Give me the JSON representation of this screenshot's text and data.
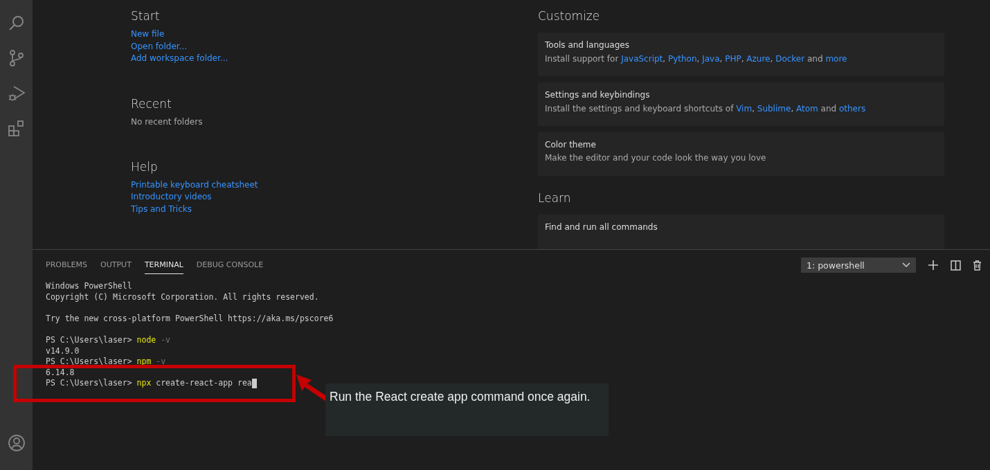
{
  "activity_bar": {
    "items": [
      {
        "kind": "search",
        "selected": false
      },
      {
        "kind": "source-control",
        "selected": false
      },
      {
        "kind": "run",
        "selected": false
      },
      {
        "kind": "extensions",
        "selected": false
      }
    ]
  },
  "welcome": {
    "left": [
      {
        "heading": "Start",
        "items": [
          {
            "text": "New file",
            "kind": "link"
          },
          {
            "text": "Open folder...",
            "kind": "link"
          },
          {
            "text": "Add workspace folder...",
            "kind": "link"
          }
        ]
      },
      {
        "heading": "Recent",
        "items": [
          {
            "text": "No recent folders",
            "kind": "plain"
          }
        ]
      },
      {
        "heading": "Help",
        "items": [
          {
            "text": "Printable keyboard cheatsheet",
            "kind": "link"
          },
          {
            "text": "Introductory videos",
            "kind": "link"
          },
          {
            "text": "Tips and Tricks",
            "kind": "link"
          }
        ]
      }
    ],
    "right": [
      {
        "heading": "Customize",
        "cards": [
          {
            "title": "Tools and languages",
            "description": [
              {
                "text": "Install support for ",
                "link": false
              },
              {
                "text": "JavaScript",
                "link": true
              },
              {
                "text": ", ",
                "link": false
              },
              {
                "text": "Python",
                "link": true
              },
              {
                "text": ", ",
                "link": false
              },
              {
                "text": "Java",
                "link": true
              },
              {
                "text": ", ",
                "link": false
              },
              {
                "text": "PHP",
                "link": true
              },
              {
                "text": ", ",
                "link": false
              },
              {
                "text": "Azure",
                "link": true
              },
              {
                "text": ", ",
                "link": false
              },
              {
                "text": "Docker",
                "link": true
              },
              {
                "text": " and ",
                "link": false
              },
              {
                "text": "more",
                "link": true
              }
            ]
          },
          {
            "title": "Settings and keybindings",
            "description": [
              {
                "text": "Install the settings and keyboard shortcuts of ",
                "link": false
              },
              {
                "text": "Vim",
                "link": true
              },
              {
                "text": ", ",
                "link": false
              },
              {
                "text": "Sublime",
                "link": true
              },
              {
                "text": ", ",
                "link": false
              },
              {
                "text": "Atom",
                "link": true
              },
              {
                "text": " and ",
                "link": false
              },
              {
                "text": "others",
                "link": true
              }
            ]
          },
          {
            "title": "Color theme",
            "description": [
              {
                "text": "Make the editor and your code look the way you love",
                "link": false
              }
            ]
          }
        ]
      },
      {
        "heading": "Learn",
        "cards": [
          {
            "title": "Find and run all commands"
          }
        ]
      }
    ]
  },
  "panel": {
    "tabs": [
      {
        "label": "PROBLEMS",
        "selected": false
      },
      {
        "label": "OUTPUT",
        "selected": false
      },
      {
        "label": "TERMINAL",
        "selected": true
      },
      {
        "label": "DEBUG CONSOLE",
        "selected": false
      }
    ],
    "terminal_select": {
      "value": "1: powershell"
    },
    "terminal": [
      {
        "kind": "text",
        "segments": [
          {
            "text": "Windows PowerShell",
            "kind": "plain"
          }
        ]
      },
      {
        "kind": "text",
        "segments": [
          {
            "text": "Copyright (C) Microsoft Corporation. All rights reserved.",
            "kind": "plain"
          }
        ]
      },
      {
        "kind": "blank"
      },
      {
        "kind": "text",
        "segments": [
          {
            "text": "Try the new cross-platform PowerShell https://aka.ms/pscore6",
            "kind": "plain"
          }
        ]
      },
      {
        "kind": "blank"
      },
      {
        "kind": "text",
        "segments": [
          {
            "text": "PS C:\\Users\\laser> ",
            "kind": "plain"
          },
          {
            "text": "node",
            "kind": "command"
          },
          {
            "text": " -v",
            "kind": "flag"
          }
        ]
      },
      {
        "kind": "text",
        "segments": [
          {
            "text": "v14.9.0",
            "kind": "plain"
          }
        ]
      },
      {
        "kind": "text",
        "segments": [
          {
            "text": "PS C:\\Users\\laser> ",
            "kind": "plain"
          },
          {
            "text": "npm",
            "kind": "command"
          },
          {
            "text": " -v",
            "kind": "flag"
          }
        ]
      },
      {
        "kind": "text",
        "segments": [
          {
            "text": "6.14.8",
            "kind": "plain"
          }
        ]
      },
      {
        "kind": "text",
        "segments": [
          {
            "text": "PS C:\\Users\\laser> ",
            "kind": "plain"
          },
          {
            "text": "npx",
            "kind": "command"
          },
          {
            "text": " create-react-app rea",
            "kind": "plain"
          }
        ]
      }
    ]
  },
  "callout": {
    "text": "Run the React create app command once again."
  }
}
